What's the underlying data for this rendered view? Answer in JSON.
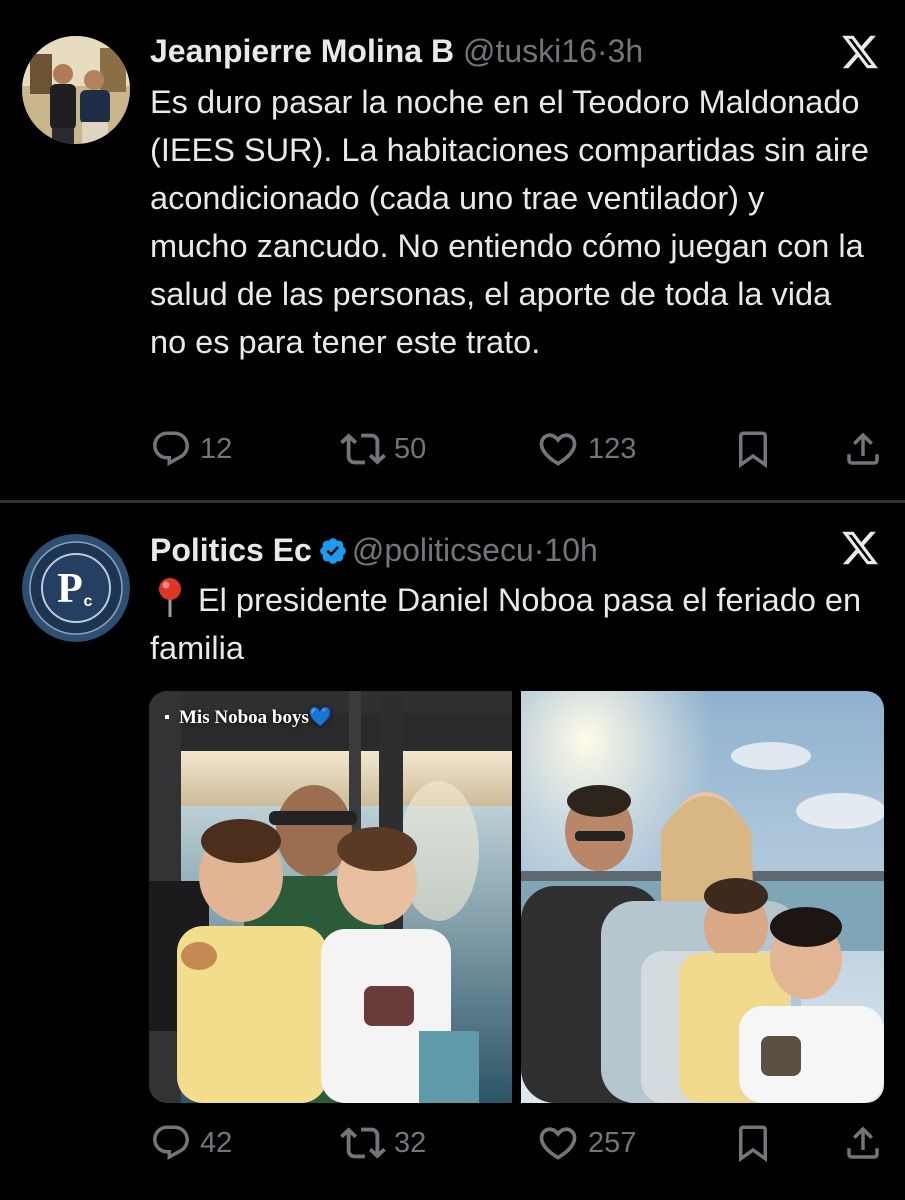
{
  "tweets": [
    {
      "author_name": "Jeanpierre Molina B",
      "handle": "@tuski16",
      "time": "3h",
      "verified": false,
      "text": "Es duro pasar la noche en el Teodoro Maldonado (IEES SUR). La habitaciones compartidas sin aire acondicionado (cada uno trae ventilador) y mucho zancudo. No entiendo cómo juegan con la salud de las personas, el aporte de toda la vida no es para tener este trato.",
      "replies": "12",
      "retweets": "50",
      "likes": "123"
    },
    {
      "author_name": "Politics Ec",
      "handle": "@politicsecu",
      "time": "10h",
      "verified": true,
      "text": "El presidente Daniel Noboa pasa el feriado en familia",
      "leading_icon": "round-pushpin-icon",
      "media_caption": "Mis Noboa boys💙",
      "replies": "42",
      "retweets": "32",
      "likes": "257"
    }
  ],
  "separator": "·",
  "colors": {
    "background": "#000000",
    "text_primary": "#e7e9ea",
    "text_secondary": "#71767b",
    "verified_blue": "#1d9bf0",
    "divider": "#2f3336"
  }
}
